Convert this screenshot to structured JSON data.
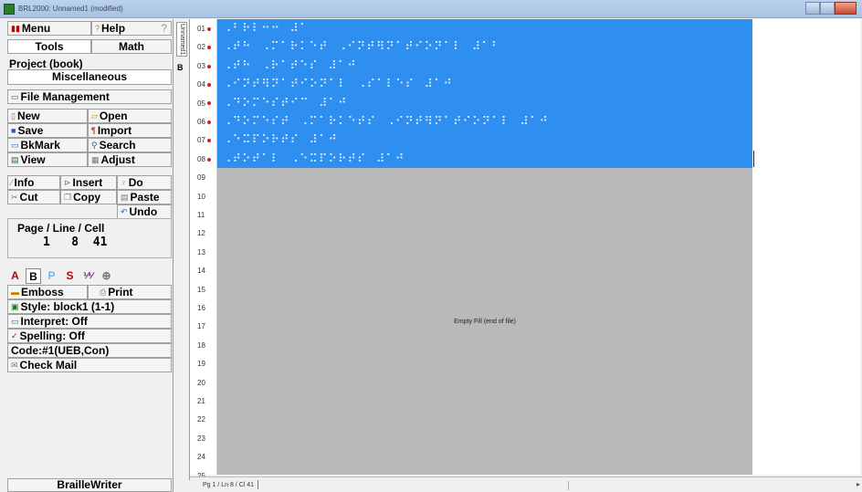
{
  "window": {
    "title": "BRL2000: Unnamed1 (modified)"
  },
  "panel": {
    "menu_label": "Menu",
    "help_label": "Help",
    "help_q": "?",
    "tab_tools": "Tools",
    "tab_math": "Math",
    "project_label": "Project (book)",
    "project_value": "Miscellaneous",
    "file_management": "File Management",
    "file_buttons": [
      [
        "New",
        "Open"
      ],
      [
        "Save",
        "Import"
      ],
      [
        "BkMark",
        "Search"
      ],
      [
        "View",
        "Adjust"
      ]
    ],
    "edit_buttons_row1": [
      "Info",
      "Insert",
      "Do"
    ],
    "edit_buttons_row2": [
      "Cut",
      "Copy",
      "Paste"
    ],
    "undo": "Undo",
    "status_header": "Page / Line / Cell",
    "status_values": "1   8  41",
    "modes": [
      "A",
      "B",
      "P",
      "S"
    ],
    "emboss": "Emboss",
    "print": "Print",
    "style": "Style: block1 (1-1)",
    "interpret": "Interpret: Off",
    "spelling": "Spelling: Off",
    "code": "Code:#1(UEB,Con)",
    "check_mail": "Check Mail",
    "braillewriter": "BrailleWriter"
  },
  "tabstrip": {
    "doc_tab": "Unnamed1",
    "mode_letter": "B"
  },
  "editor": {
    "line_numbers": [
      "01",
      "02",
      "03",
      "04",
      "05",
      "06",
      "07",
      "08",
      "09",
      "10",
      "11",
      "12",
      "13",
      "14",
      "15",
      "16",
      "17",
      "18",
      "19",
      "20",
      "21",
      "22",
      "23",
      "24",
      "25"
    ],
    "marked_lines": 8,
    "braille_lines": [
      "⠠⠃⠗⠇⠒⠒  ⠼⠁",
      "⠠⠞⠓  ⠠⠍⠁⠗⠅⠑⠞  ⠠⠊⠝⠞⠻⠝⠁⠞⠊⠕⠝⠁⠇  ⠼⠁⠃",
      "⠠⠞⠓  ⠠⠗⠁⠞⠑⠎  ⠼⠁⠚",
      "⠠⠊⠝⠞⠻⠝⠁⠞⠊⠕⠝⠁⠇  ⠠⠎⠁⠇⠑⠎  ⠼⠁⠚",
      "⠠⠙⠕⠍⠑⠎⠞⠊⠉  ⠼⠁⠚",
      "⠠⠙⠕⠍⠑⠎⠞  ⠠⠍⠁⠗⠅⠑⠞⠎  ⠠⠊⠝⠞⠻⠝⠁⠞⠊⠕⠝⠁⠇  ⠼⠁⠚",
      "⠠⠑⠭⠏⠕⠗⠞⠎  ⠼⠁⠚",
      "⠠⠞⠕⠞⠁⠇  ⠠⠑⠭⠏⠕⠗⠞⠎  ⠼⠁⠚"
    ],
    "end_of_file": "Empty Fill (end of file)"
  },
  "statusbar": {
    "position": "Pg 1 / Ln 8 / Cl 41"
  }
}
